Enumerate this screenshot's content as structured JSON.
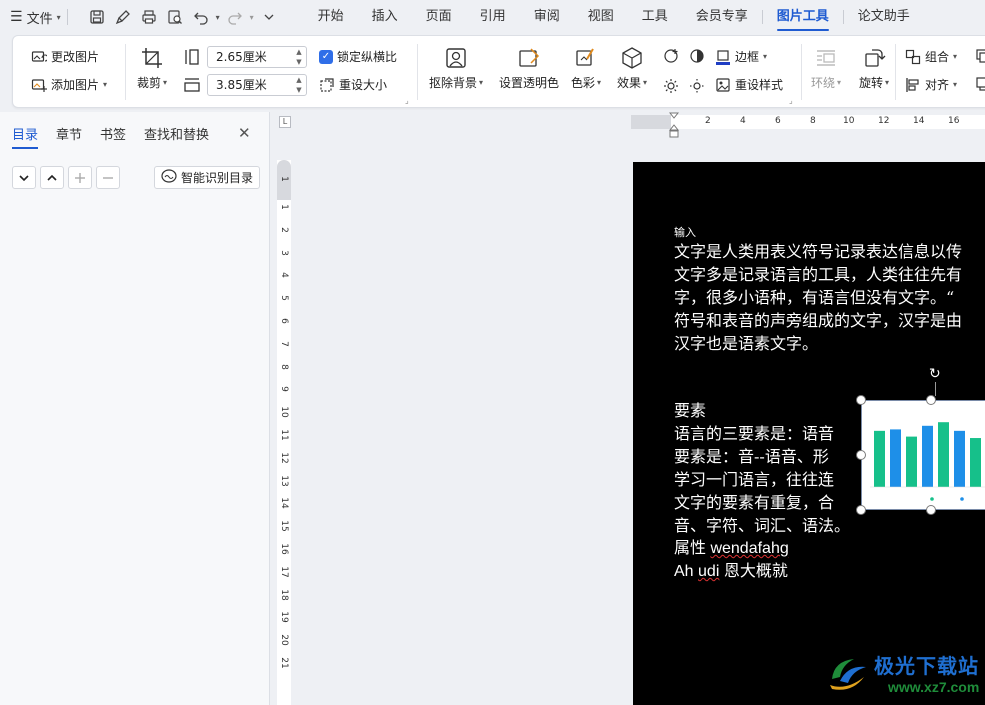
{
  "menubar": {
    "file_label": "文件",
    "tabs": [
      {
        "label": "开始"
      },
      {
        "label": "插入"
      },
      {
        "label": "页面"
      },
      {
        "label": "引用"
      },
      {
        "label": "审阅"
      },
      {
        "label": "视图"
      },
      {
        "label": "工具"
      },
      {
        "label": "会员专享"
      },
      {
        "label": "图片工具"
      },
      {
        "label": "论文助手"
      }
    ],
    "active_tab": "图片工具"
  },
  "ribbon": {
    "change_picture": "更改图片",
    "add_picture": "添加图片",
    "crop": "裁剪",
    "width_value": "2.65厘米",
    "height_value": "3.85厘米",
    "lock_ratio": "锁定纵横比",
    "reset_size": "重设大小",
    "remove_bg": "抠除背景",
    "set_transparent": "设置透明色",
    "color": "色彩",
    "effects": "效果",
    "border": "边框",
    "reset_style": "重设样式",
    "wrap": "环绕",
    "rotate": "旋转",
    "group": "组合",
    "align": "对齐"
  },
  "leftpane": {
    "tabs": [
      {
        "label": "目录"
      },
      {
        "label": "章节"
      },
      {
        "label": "书签"
      },
      {
        "label": "查找和替换"
      }
    ],
    "smart_toc": "智能识别目录"
  },
  "ruler": {
    "h_ticks": [
      "2",
      "4",
      "6",
      "8",
      "10",
      "12",
      "14",
      "16"
    ],
    "v_ticks": [
      "1",
      "1",
      "2",
      "3",
      "4",
      "5",
      "6",
      "7",
      "8",
      "9",
      "10",
      "11",
      "12",
      "13",
      "14",
      "15",
      "16",
      "17",
      "18",
      "19",
      "20",
      "21"
    ]
  },
  "document": {
    "small_label": "输入",
    "para_lines": [
      "文字是人类用表义符号记录表达信息以传",
      "文字多是记录语言的工具，人类往往先有",
      "字，很多小语种，有语言但没有文字。“",
      "符号和表音的声旁组成的文字，汉字是由",
      "汉字也是语素文字。"
    ],
    "heading": "要素",
    "para2_lines": [
      "语言的三要素是：语音",
      "要素是：音--语音、形",
      "学习一门语言，往往连",
      "文字的要素有重复，合",
      "音、字符、词汇、语法。"
    ],
    "attr_prefix": "属性 ",
    "attr_word": "wendafahg",
    "last_prefix": "Ah ",
    "last_word": "udi",
    "last_suffix": " 恩大概就"
  },
  "embedded_chart": {
    "bars": [
      {
        "value": 0.78,
        "color": "#16c08a"
      },
      {
        "value": 0.8,
        "color": "#1e8fe8"
      },
      {
        "value": 0.7,
        "color": "#16c08a"
      },
      {
        "value": 0.85,
        "color": "#1e8fe8"
      },
      {
        "value": 0.9,
        "color": "#16c08a"
      },
      {
        "value": 0.78,
        "color": "#1e8fe8"
      },
      {
        "value": 0.68,
        "color": "#16c08a"
      }
    ]
  },
  "watermark": {
    "brand": "极光下载站",
    "url": "www.xz7.com"
  },
  "colors": {
    "accent": "#1f5bd1",
    "checkbox": "#2f6ee8"
  }
}
